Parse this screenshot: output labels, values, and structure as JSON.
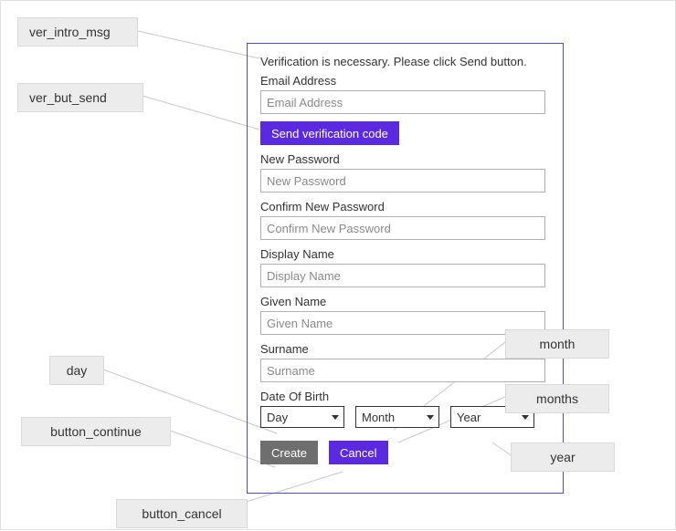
{
  "form": {
    "intro_msg": "Verification is necessary. Please click Send button.",
    "email": {
      "label": "Email Address",
      "placeholder": "Email Address"
    },
    "send_button": "Send verification code",
    "new_password": {
      "label": "New Password",
      "placeholder": "New Password"
    },
    "confirm_password": {
      "label": "Confirm New Password",
      "placeholder": "Confirm New Password"
    },
    "display_name": {
      "label": "Display Name",
      "placeholder": "Display Name"
    },
    "given_name": {
      "label": "Given Name",
      "placeholder": "Given Name"
    },
    "surname": {
      "label": "Surname",
      "placeholder": "Surname"
    },
    "dob": {
      "label": "Date Of Birth",
      "day": "Day",
      "month": "Month",
      "year": "Year"
    },
    "create_button": "Create",
    "cancel_button": "Cancel"
  },
  "annotations": {
    "ver_intro_msg": "ver_intro_msg",
    "ver_but_send": "ver_but_send",
    "day": "day",
    "button_continue": "button_continue",
    "button_cancel": "button_cancel",
    "month": "month",
    "months": "months",
    "year": "year"
  },
  "colors": {
    "panel_border": "#4a49e0",
    "primary_button": "#5b29e0",
    "gray_button": "#6e6e6e",
    "annotation_bg": "#ececec"
  }
}
